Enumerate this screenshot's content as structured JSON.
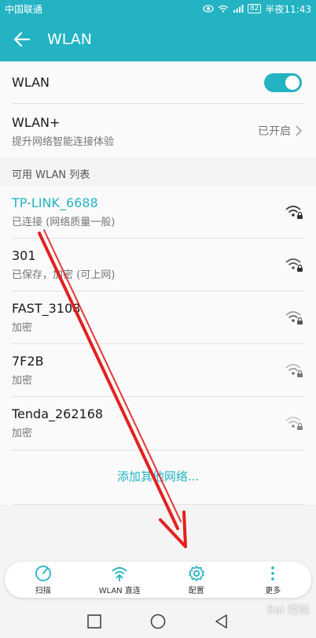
{
  "status_bar": {
    "carrier": "中国联通",
    "battery": "82",
    "time": "半夜11:43"
  },
  "app_bar": {
    "title": "WLAN"
  },
  "wlan_toggle": {
    "label": "WLAN",
    "state": "on"
  },
  "wlan_plus": {
    "title": "WLAN+",
    "subtitle": "提升网络智能连接体验",
    "status": "已开启"
  },
  "list_header": "可用 WLAN 列表",
  "networks": [
    {
      "ssid": "TP-LINK_6688",
      "status": "已连接 (网络质量一般)",
      "connected": true
    },
    {
      "ssid": "301",
      "status": "已保存，加密 (可上网)",
      "connected": false
    },
    {
      "ssid": "FAST_3108",
      "status": "加密",
      "connected": false
    },
    {
      "ssid": "7F2B",
      "status": "加密",
      "connected": false
    },
    {
      "ssid": "Tenda_262168",
      "status": "加密",
      "connected": false
    }
  ],
  "add_network": "添加其他网络...",
  "bottom_actions": [
    {
      "label": "扫描",
      "icon": "scan-icon"
    },
    {
      "label": "WLAN 直连",
      "icon": "wifi-direct-icon"
    },
    {
      "label": "配置",
      "icon": "gear-icon"
    },
    {
      "label": "更多",
      "icon": "more-icon"
    }
  ],
  "accent_color": "#23b3c3",
  "watermark": "Bai 经验"
}
